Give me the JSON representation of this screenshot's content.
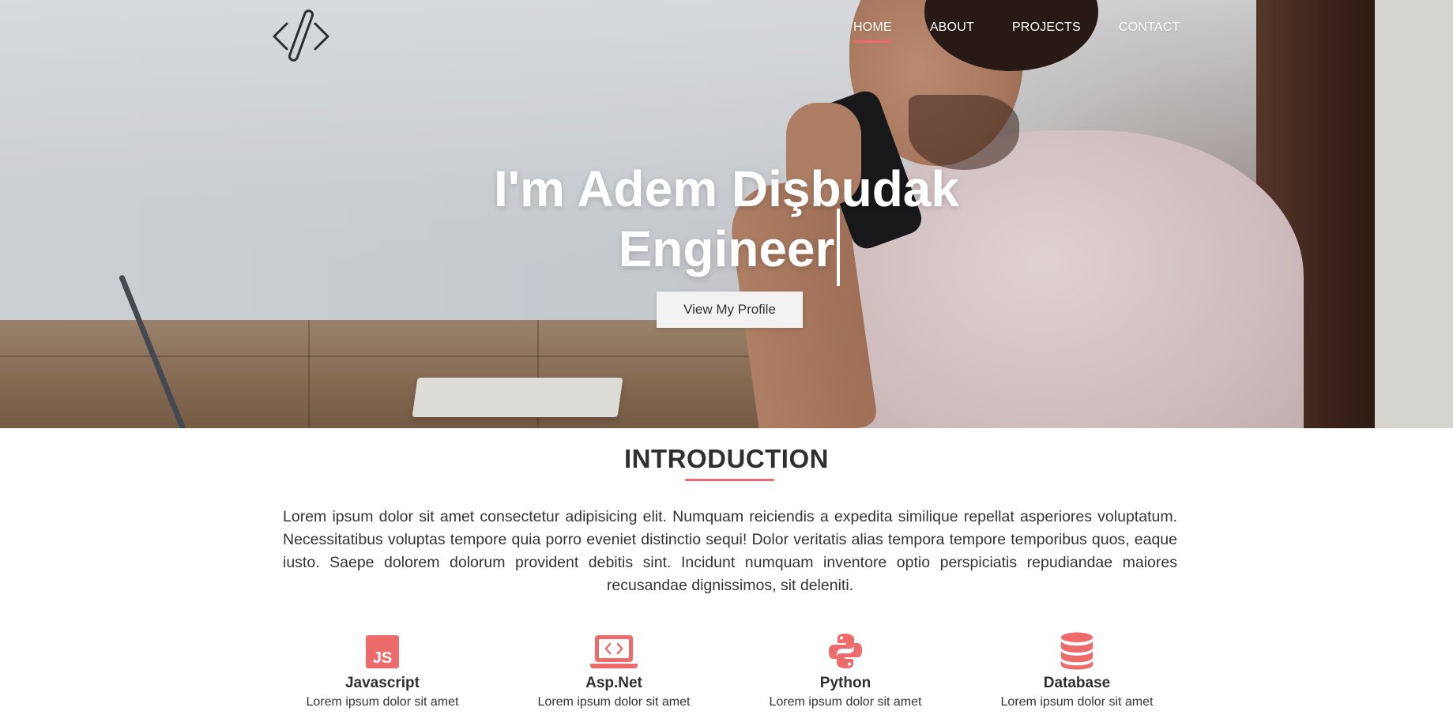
{
  "nav": {
    "items": [
      "HOME",
      "ABOUT",
      "PROJECTS",
      "CONTACT"
    ],
    "active": "HOME"
  },
  "logo": {
    "icon": "code-brackets-icon"
  },
  "hero": {
    "line1": "I'm Adem Dişbudak",
    "line2": "Engineer",
    "cta_label": "View My Profile"
  },
  "intro": {
    "title": "INTRODUCTION",
    "body": "Lorem ipsum dolor sit amet consectetur adipisicing elit. Numquam reiciendis a expedita similique repellat asperiores voluptatum. Necessitatibus voluptas tempore quia porro eveniet distinctio sequi! Dolor veritatis alias tempora tempore temporibus quos, eaque iusto. Saepe dolorem dolorum provident debitis sint. Incidunt numquam inventore optio perspiciatis repudiandae maiores recusandae dignissimos, sit deleniti."
  },
  "skills": [
    {
      "name": "Javascript",
      "desc": "Lorem ipsum dolor sit amet",
      "icon": "js-icon"
    },
    {
      "name": "Asp.Net",
      "desc": "Lorem ipsum dolor sit amet",
      "icon": "laptop-code-icon"
    },
    {
      "name": "Python",
      "desc": "Lorem ipsum dolor sit amet",
      "icon": "python-icon"
    },
    {
      "name": "Database",
      "desc": "Lorem ipsum dolor sit amet",
      "icon": "database-icon"
    }
  ],
  "colors": {
    "accent": "#ee6b6b",
    "text": "#2f2f2f",
    "button_bg": "#f2f2f2"
  }
}
